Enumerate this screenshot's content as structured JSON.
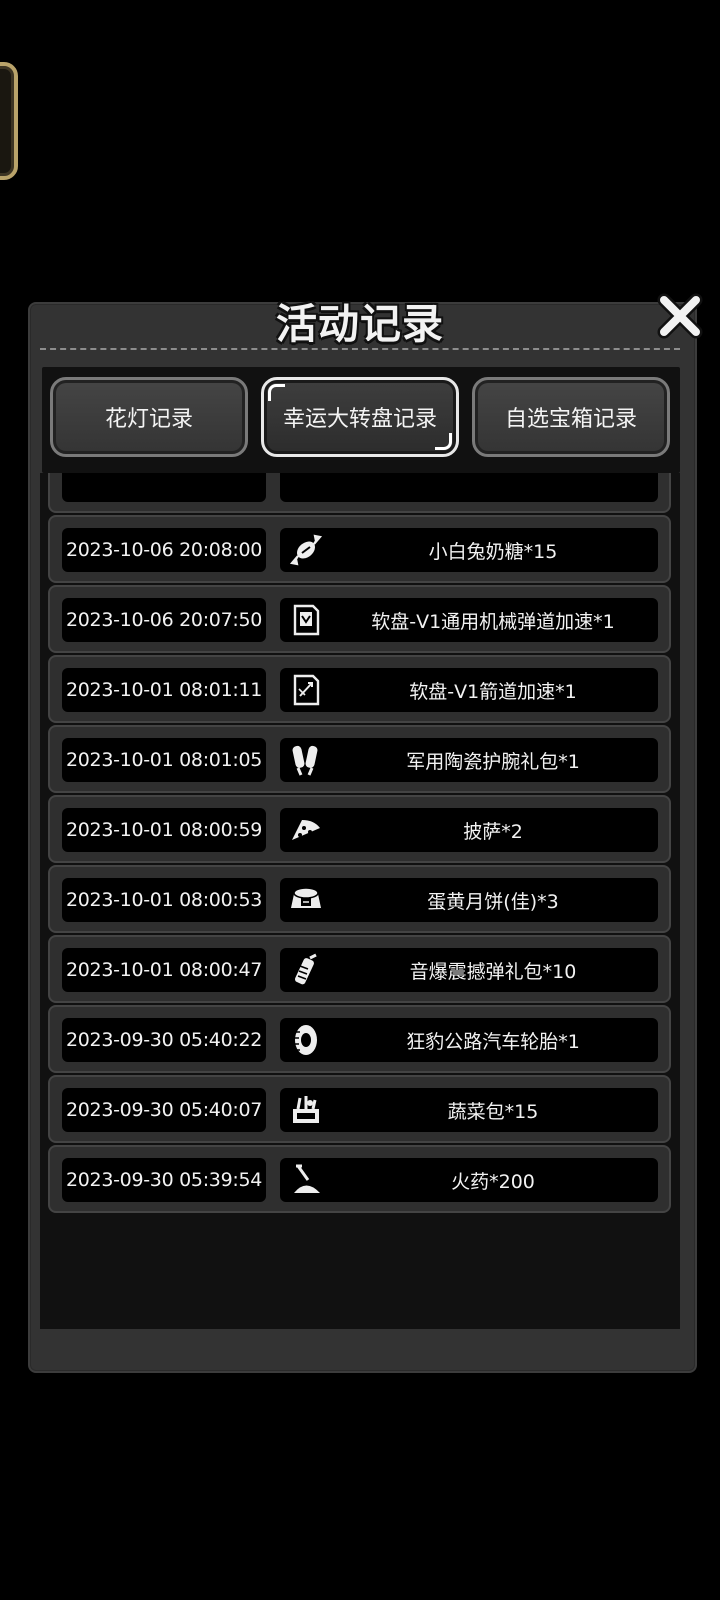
{
  "panel": {
    "title": "活动记录"
  },
  "tabs": [
    {
      "label": "花灯记录",
      "active": false
    },
    {
      "label": "幸运大转盘记录",
      "active": true
    },
    {
      "label": "自选宝箱记录",
      "active": false
    }
  ],
  "records": [
    {
      "time": "2023-10-06 20:08:00",
      "name": "小白兔奶糖*15",
      "icon": "candy-icon"
    },
    {
      "time": "2023-10-06 20:07:50",
      "name": "软盘-V1通用机械弹道加速*1",
      "icon": "floppy-disk-icon"
    },
    {
      "time": "2023-10-01 08:01:11",
      "name": "软盘-V1箭道加速*1",
      "icon": "floppy-disk-arrow-icon"
    },
    {
      "time": "2023-10-01 08:01:05",
      "name": "军用陶瓷护腕礼包*1",
      "icon": "wrist-guard-icon"
    },
    {
      "time": "2023-10-01 08:00:59",
      "name": "披萨*2",
      "icon": "pizza-icon"
    },
    {
      "time": "2023-10-01 08:00:53",
      "name": "蛋黄月饼(佳)*3",
      "icon": "mooncake-icon"
    },
    {
      "time": "2023-10-01 08:00:47",
      "name": "音爆震撼弹礼包*10",
      "icon": "grenade-icon"
    },
    {
      "time": "2023-09-30 05:40:22",
      "name": "狂豹公路汽车轮胎*1",
      "icon": "tire-icon"
    },
    {
      "time": "2023-09-30 05:40:07",
      "name": "蔬菜包*15",
      "icon": "vegetable-basket-icon"
    },
    {
      "time": "2023-09-30 05:39:54",
      "name": "火药*200",
      "icon": "gunpowder-icon"
    }
  ]
}
